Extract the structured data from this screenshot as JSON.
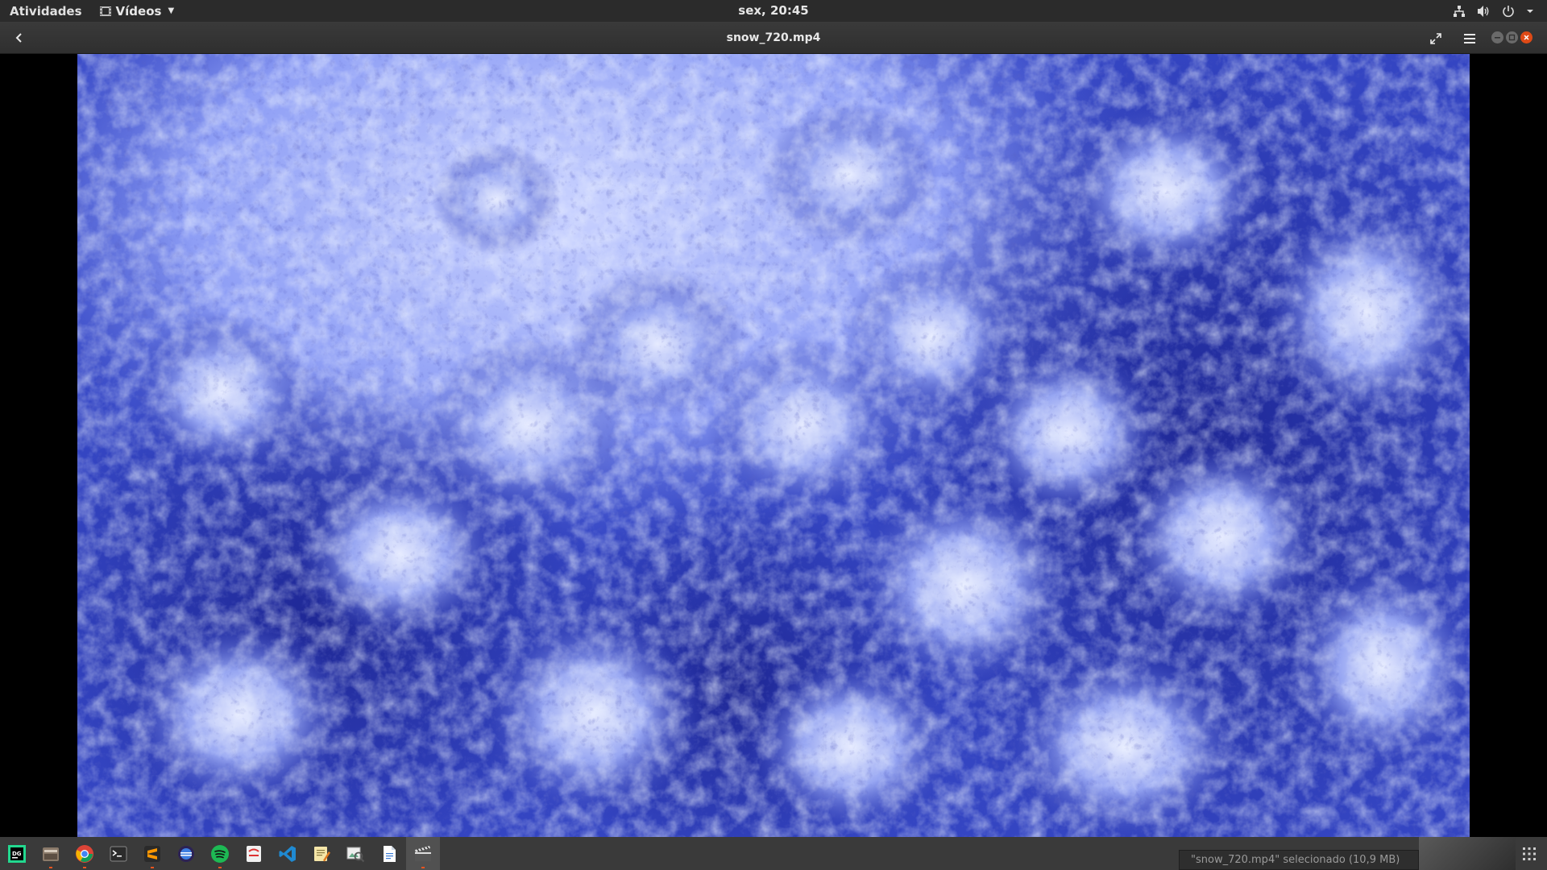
{
  "topbar": {
    "activities": "Atividades",
    "app_name": "Vídeos",
    "clock": "sex, 20:45",
    "tray_icons": [
      "network-icon",
      "volume-icon",
      "power-icon",
      "chevron-down-icon"
    ]
  },
  "window": {
    "title": "snow_720.mp4",
    "buttons": [
      "back-icon",
      "fullscreen-icon",
      "hamburger-menu-icon",
      "minimize-icon",
      "maximize-icon",
      "close-icon"
    ]
  },
  "video": {
    "subject": "snow_720.mp4"
  },
  "dock": {
    "items": [
      {
        "name": "datagrip-icon",
        "active": false
      },
      {
        "name": "file-manager-icon",
        "active": false
      },
      {
        "name": "chrome-icon",
        "active": false
      },
      {
        "name": "terminal-icon",
        "active": false
      },
      {
        "name": "sublime-text-icon",
        "active": false
      },
      {
        "name": "eclipse-icon",
        "active": false
      },
      {
        "name": "spotify-icon",
        "active": false
      },
      {
        "name": "app-icon",
        "active": false
      },
      {
        "name": "vscode-icon",
        "active": false
      },
      {
        "name": "text-editor-icon",
        "active": false
      },
      {
        "name": "image-viewer-icon",
        "active": false
      },
      {
        "name": "document-viewer-icon",
        "active": false
      },
      {
        "name": "videos-icon",
        "active": true
      }
    ],
    "status_text": "\"snow_720.mp4\" selecionado (10,9 MB)"
  },
  "colors": {
    "topbar": "#2b2b2b",
    "headerbar": "#353535",
    "close": "#df4a16",
    "video_tint": "#3a4fc4"
  }
}
